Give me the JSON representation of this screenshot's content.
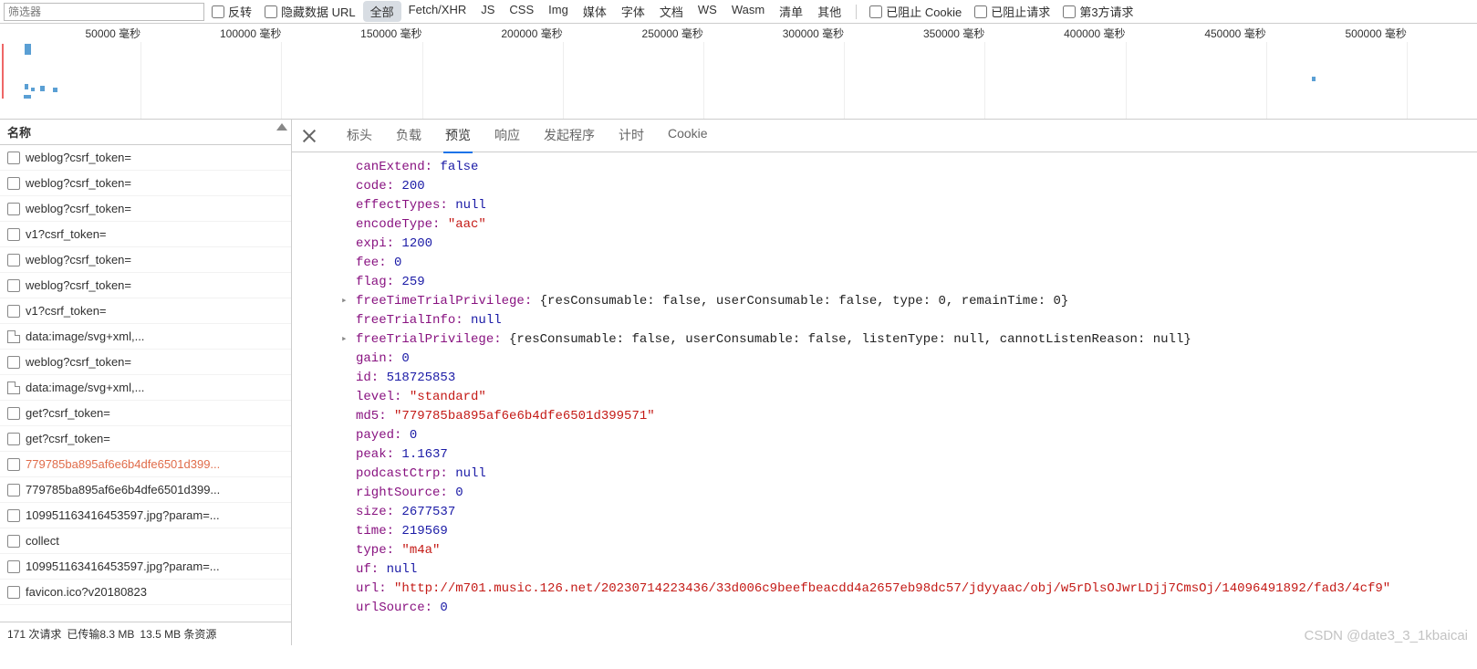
{
  "toolbar": {
    "filter_placeholder": "筛选器",
    "invert": "反转",
    "hide_data_urls": "隐藏数据 URL",
    "types": [
      "全部",
      "Fetch/XHR",
      "JS",
      "CSS",
      "Img",
      "媒体",
      "字体",
      "文档",
      "WS",
      "Wasm",
      "清单",
      "其他"
    ],
    "active_type": 0,
    "blocked_cookies": "已阻止 Cookie",
    "blocked_requests": "已阻止请求",
    "third_party": "第3方请求"
  },
  "timeline": {
    "unit": "毫秒",
    "ticks": [
      50000,
      100000,
      150000,
      200000,
      250000,
      300000,
      350000,
      400000,
      450000,
      500000
    ]
  },
  "requests_header": "名称",
  "requests": [
    {
      "icon": "doc",
      "name": "weblog?csrf_token="
    },
    {
      "icon": "doc",
      "name": "weblog?csrf_token="
    },
    {
      "icon": "doc",
      "name": "weblog?csrf_token="
    },
    {
      "icon": "doc",
      "name": "v1?csrf_token="
    },
    {
      "icon": "doc",
      "name": "weblog?csrf_token="
    },
    {
      "icon": "doc",
      "name": "weblog?csrf_token="
    },
    {
      "icon": "doc",
      "name": "v1?csrf_token="
    },
    {
      "icon": "file",
      "name": "data:image/svg+xml,..."
    },
    {
      "icon": "doc",
      "name": "weblog?csrf_token="
    },
    {
      "icon": "file",
      "name": "data:image/svg+xml,..."
    },
    {
      "icon": "doc",
      "name": "get?csrf_token="
    },
    {
      "icon": "doc",
      "name": "get?csrf_token="
    },
    {
      "icon": "doc",
      "name": "779785ba895af6e6b4dfe6501d399...",
      "selected": true
    },
    {
      "icon": "doc",
      "name": "779785ba895af6e6b4dfe6501d399..."
    },
    {
      "icon": "doc",
      "name": "109951163416453597.jpg?param=..."
    },
    {
      "icon": "doc",
      "name": "collect"
    },
    {
      "icon": "doc",
      "name": "109951163416453597.jpg?param=..."
    },
    {
      "icon": "doc",
      "name": "favicon.ico?v20180823"
    }
  ],
  "status_bar": {
    "requests": "171 次请求",
    "transferred": "已传输8.3 MB",
    "resources": "13.5 MB 条资源"
  },
  "detail_tabs": [
    "标头",
    "负载",
    "预览",
    "响应",
    "发起程序",
    "计时",
    "Cookie"
  ],
  "active_tab": 2,
  "preview_lines": [
    {
      "k": "canExtend",
      "t": "bool",
      "v": "false"
    },
    {
      "k": "code",
      "t": "num",
      "v": "200"
    },
    {
      "k": "effectTypes",
      "t": "null",
      "v": "null"
    },
    {
      "k": "encodeType",
      "t": "str",
      "v": "\"aac\""
    },
    {
      "k": "expi",
      "t": "num",
      "v": "1200"
    },
    {
      "k": "fee",
      "t": "num",
      "v": "0"
    },
    {
      "k": "flag",
      "t": "num",
      "v": "259"
    },
    {
      "k": "freeTimeTrialPrivilege",
      "t": "obj",
      "v": "{resConsumable: false, userConsumable: false, type: 0, remainTime: 0}",
      "exp": true
    },
    {
      "k": "freeTrialInfo",
      "t": "null",
      "v": "null"
    },
    {
      "k": "freeTrialPrivilege",
      "t": "obj",
      "v": "{resConsumable: false, userConsumable: false, listenType: null, cannotListenReason: null}",
      "exp": true
    },
    {
      "k": "gain",
      "t": "num",
      "v": "0"
    },
    {
      "k": "id",
      "t": "num",
      "v": "518725853"
    },
    {
      "k": "level",
      "t": "str",
      "v": "\"standard\""
    },
    {
      "k": "md5",
      "t": "str",
      "v": "\"779785ba895af6e6b4dfe6501d399571\""
    },
    {
      "k": "payed",
      "t": "num",
      "v": "0"
    },
    {
      "k": "peak",
      "t": "num",
      "v": "1.1637"
    },
    {
      "k": "podcastCtrp",
      "t": "null",
      "v": "null"
    },
    {
      "k": "rightSource",
      "t": "num",
      "v": "0"
    },
    {
      "k": "size",
      "t": "num",
      "v": "2677537"
    },
    {
      "k": "time",
      "t": "num",
      "v": "219569"
    },
    {
      "k": "type",
      "t": "str",
      "v": "\"m4a\""
    },
    {
      "k": "uf",
      "t": "null",
      "v": "null"
    },
    {
      "k": "url",
      "t": "str",
      "v": "\"http://m701.music.126.net/20230714223436/33d006c9beefbeacdd4a2657eb98dc57/jdyyaac/obj/w5rDlsOJwrLDjj7CmsOj/14096491892/fad3/4cf9\""
    },
    {
      "k": "urlSource",
      "t": "num",
      "v": "0"
    }
  ],
  "watermark": "CSDN @date3_3_1kbaicai"
}
